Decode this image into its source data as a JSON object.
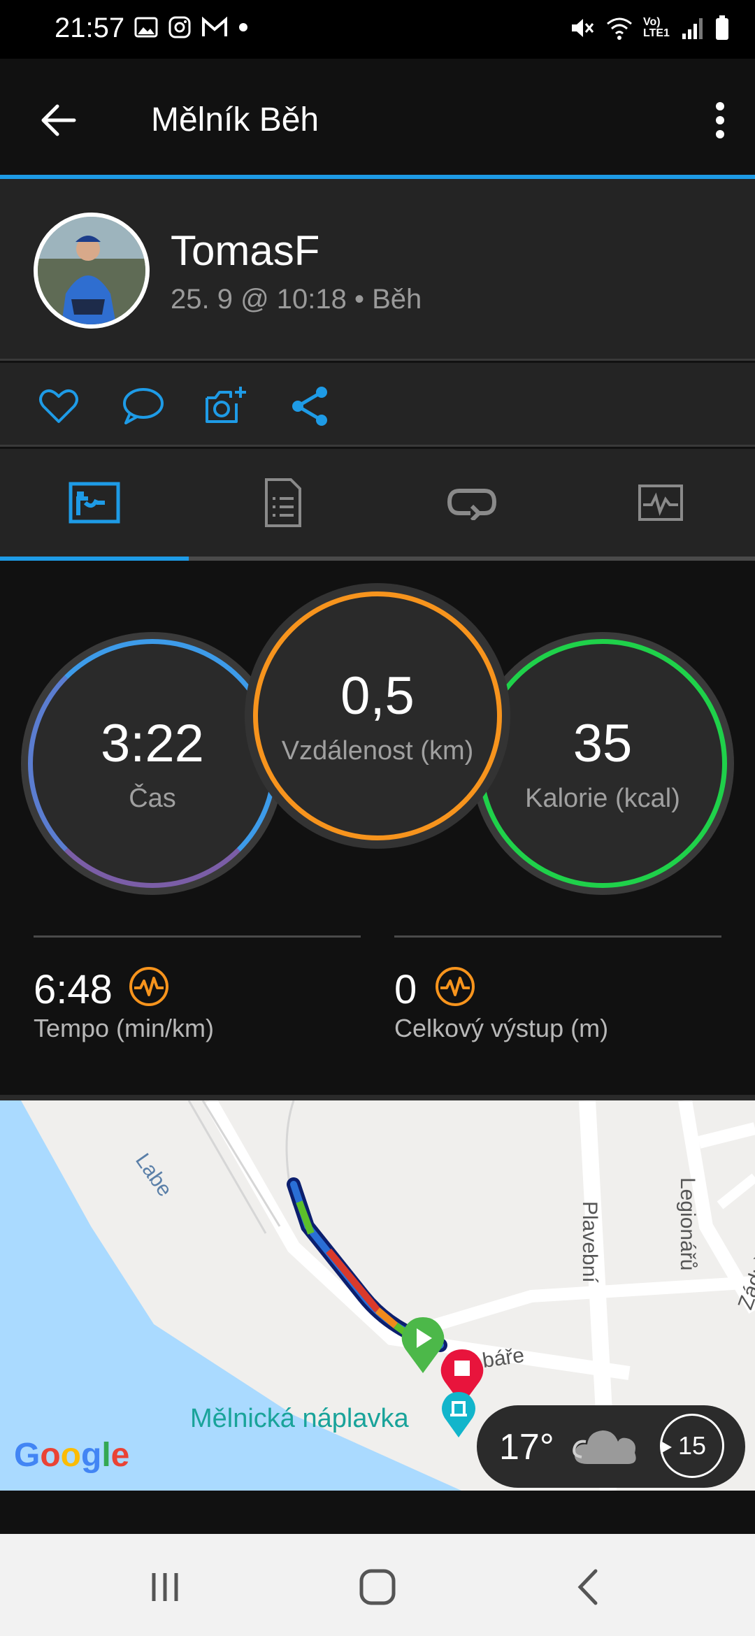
{
  "status": {
    "time": "21:57",
    "network": "Vo) LTE1"
  },
  "app_bar": {
    "title": "Mělník Běh"
  },
  "profile": {
    "name": "TomasF",
    "meta": "25. 9 @ 10:18 • Běh"
  },
  "actions": [
    "heart-icon",
    "comment-icon",
    "camera-add-icon",
    "share-icon"
  ],
  "tabs": [
    {
      "icon": "stats-tab-icon",
      "active": true
    },
    {
      "icon": "details-tab-icon",
      "active": false
    },
    {
      "icon": "laps-tab-icon",
      "active": false
    },
    {
      "icon": "charts-tab-icon",
      "active": false
    }
  ],
  "rings": {
    "time": {
      "value": "3:22",
      "label": "Čas"
    },
    "distance": {
      "value": "0,5",
      "label": "Vzdálenost (km)"
    },
    "calories": {
      "value": "35",
      "label": "Kalorie (kcal)"
    }
  },
  "metrics": {
    "pace": {
      "value": "6:48",
      "label": "Tempo (min/km)"
    },
    "ascent": {
      "value": "0",
      "label": "Celkový výstup (m)"
    }
  },
  "map": {
    "river": "Labe",
    "streets": {
      "legionaru": "Legionářů",
      "plavebni": "Plavební",
      "zadusni": "Zádušní",
      "rybare": "báře"
    },
    "place": "Mělnická náplavka",
    "logo": "Google"
  },
  "weather": {
    "temperature": "17°",
    "wind": "15"
  },
  "colors": {
    "accent": "#1e9be6",
    "distance_ring": "#f7941d",
    "calories_ring": "#1fd14a",
    "time_ring_top": "#3d9be9",
    "time_ring_bottom": "#7b5ea7",
    "metric_icon": "#f7941d"
  }
}
